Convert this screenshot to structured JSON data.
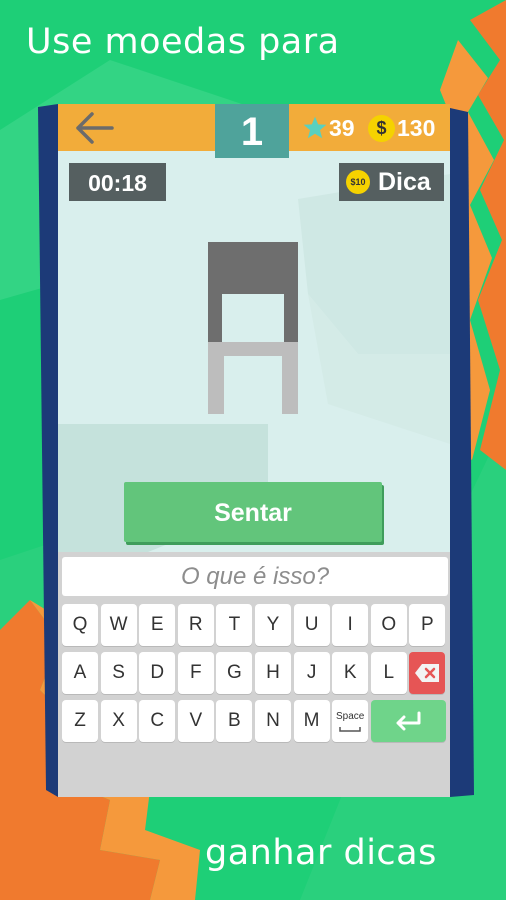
{
  "promo": {
    "top_text": "Use moedas para",
    "bottom_text": "ganhar dicas"
  },
  "header": {
    "back_icon": "arrow-left-icon",
    "level": "1",
    "stars_count": "39",
    "coin_symbol": "$",
    "coins_count": "130"
  },
  "status": {
    "timer": "00:18",
    "hint_cost": "$10",
    "hint_label": "Dica"
  },
  "puzzle": {
    "image_icon": "chair-icon",
    "answer": "Sentar"
  },
  "input": {
    "placeholder": "O que é isso?"
  },
  "keyboard": {
    "row1": [
      "Q",
      "W",
      "E",
      "R",
      "T",
      "Y",
      "U",
      "I",
      "O",
      "P"
    ],
    "row2": [
      "A",
      "S",
      "D",
      "F",
      "G",
      "H",
      "J",
      "K",
      "L"
    ],
    "row3": [
      "Z",
      "X",
      "C",
      "V",
      "B",
      "N",
      "M"
    ],
    "space_label": "Space",
    "delete_icon": "backspace-icon",
    "enter_icon": "enter-icon"
  },
  "colors": {
    "background_green": "#1ecf77",
    "topbar_orange": "#f2ac3a",
    "level_teal": "#4fa39b",
    "dark_chip": "#555f60",
    "answer_green": "#62c57b",
    "delete_red": "#e65555",
    "coin_yellow": "#f5d200",
    "phone_frame_navy": "#1c3a78"
  }
}
